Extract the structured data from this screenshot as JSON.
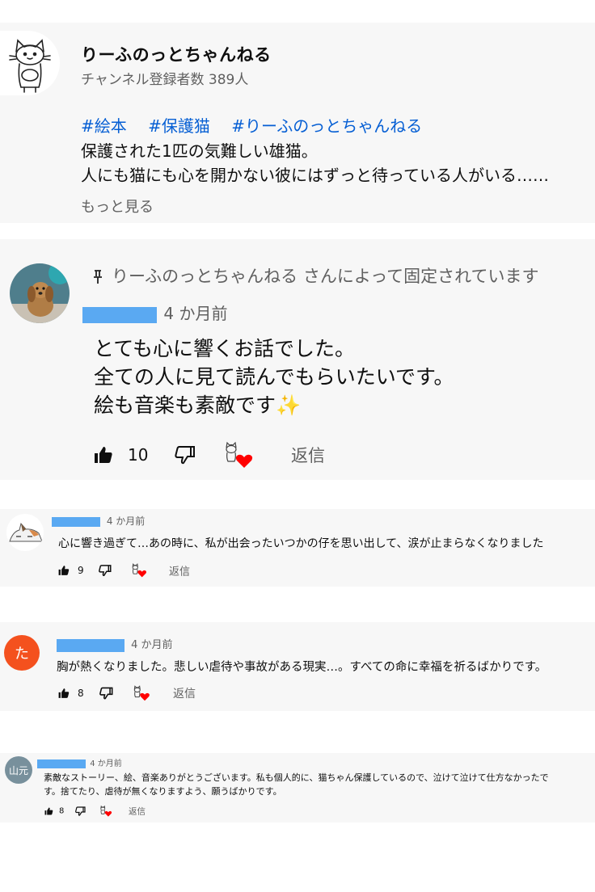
{
  "channel": {
    "name": "りーふのっとちゃんねる",
    "subscribers": "チャンネル登録者数 389人",
    "hashtags": [
      "#絵本",
      "#保護猫",
      "#りーふのっとちゃんねる"
    ],
    "description_lines": [
      "保護された1匹の気難しい雄猫。",
      "人にも猫にも心を開かない彼にはずっと待っている人がいる……"
    ],
    "more_label": "もっと見る"
  },
  "pinned_comment": {
    "pinned_by": "りーふのっとちゃんねる さんによって固定されています",
    "time": "4 か月前",
    "lines": [
      "とても心に響くお話でした。",
      "全ての人に見て読んでもらいたいです。",
      "絵も音楽も素敵です"
    ],
    "sparkle": "✨",
    "like_count": "10",
    "reply_label": "返信"
  },
  "comments": [
    {
      "time": "4 か月前",
      "text": "心に響き過ぎて…あの時に、私が出会ったいつかの仔を思い出して、涙が止まらなくなりました",
      "like_count": "9",
      "reply_label": "返信"
    },
    {
      "avatar_letter": "た",
      "avatar_color": "#f4511e",
      "time": "4 か月前",
      "text": "胸が熱くなりました。悲しい虐待や事故がある現実…。すべての命に幸福を祈るばかりです。",
      "like_count": "8",
      "reply_label": "返信"
    },
    {
      "avatar_letter": "山元",
      "avatar_color": "#78909c",
      "time": "4 か月前",
      "lines": [
        "素敵なストーリー、絵、音楽ありがとうございます。私も個人的に、猫ちゃん保護しているので、泣けて泣けて仕方なかったで",
        "す。捨てたり、虐待が無くなりますよう、願うばかりです。"
      ],
      "like_count": "8",
      "reply_label": "返信"
    }
  ],
  "icons": {
    "like": "thumbs-up-icon",
    "dislike": "thumbs-down-icon",
    "creator_heart": "creator-heart-icon",
    "pin": "pin-icon"
  },
  "colors": {
    "link": "#065fd4",
    "redaction": "#5aa9f2",
    "heart": "#ff0000"
  }
}
